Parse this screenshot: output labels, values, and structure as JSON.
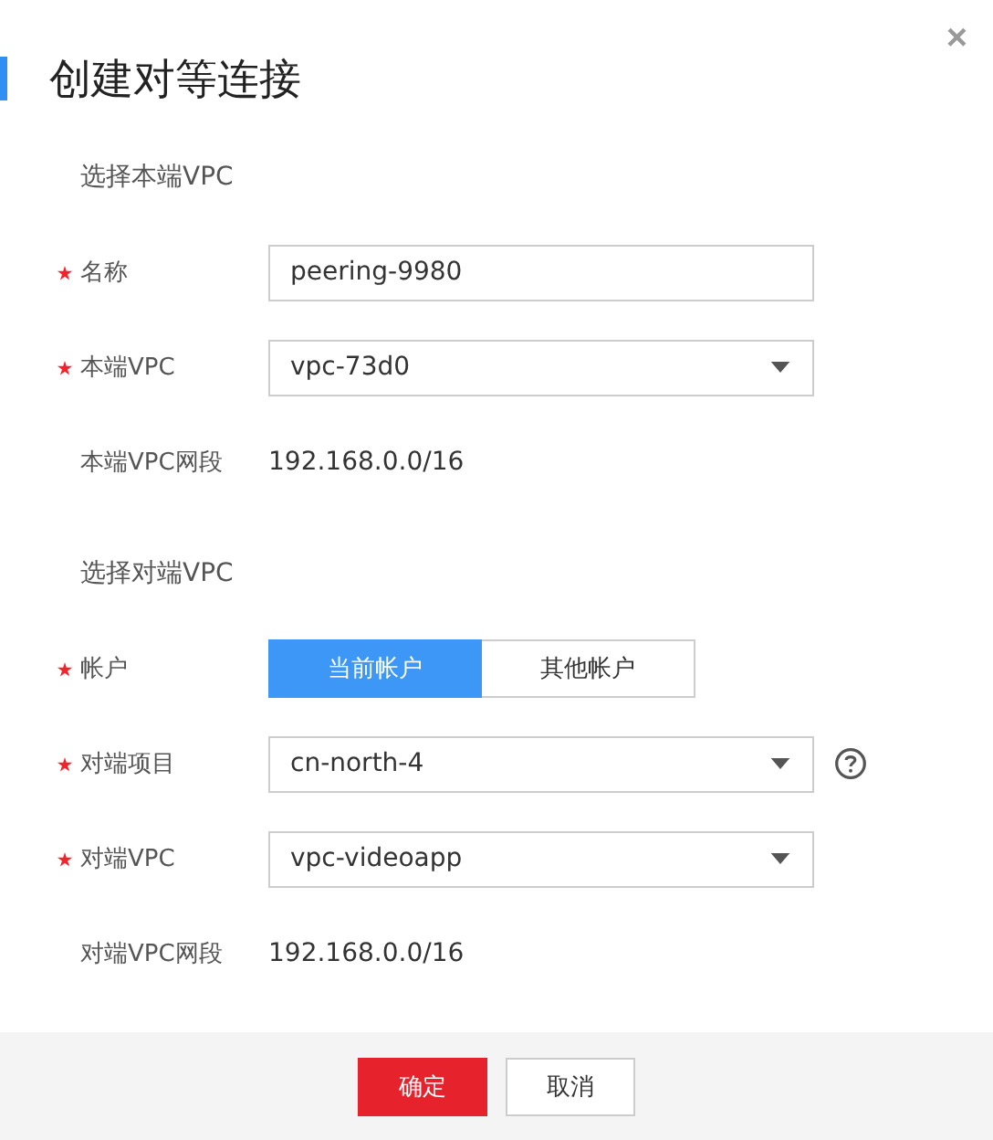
{
  "dialog": {
    "title": "创建对等连接",
    "close": "×"
  },
  "sections": [
    {
      "heading": "选择本端VPC",
      "rows": [
        {
          "kind": "input",
          "label": "名称",
          "required": true,
          "value": "peering-9980"
        },
        {
          "kind": "select",
          "label": "本端VPC",
          "required": true,
          "value": "vpc-73d0"
        },
        {
          "kind": "text",
          "label": "本端VPC网段",
          "required": false,
          "value": "192.168.0.0/16"
        }
      ]
    },
    {
      "heading": "选择对端VPC",
      "rows": [
        {
          "kind": "toggle",
          "label": "帐户",
          "required": true,
          "options": [
            {
              "label": "当前帐户",
              "selected": true
            },
            {
              "label": "其他帐户",
              "selected": false
            }
          ]
        },
        {
          "kind": "select",
          "label": "对端项目",
          "required": true,
          "value": "cn-north-4",
          "help": true
        },
        {
          "kind": "select",
          "label": "对端VPC",
          "required": true,
          "value": "vpc-videoapp"
        },
        {
          "kind": "text",
          "label": "对端VPC网段",
          "required": false,
          "value": "192.168.0.0/16"
        }
      ]
    }
  ],
  "buttons": [
    {
      "label": "确定",
      "kind": "primary"
    },
    {
      "label": "取消",
      "kind": "secondary"
    }
  ]
}
